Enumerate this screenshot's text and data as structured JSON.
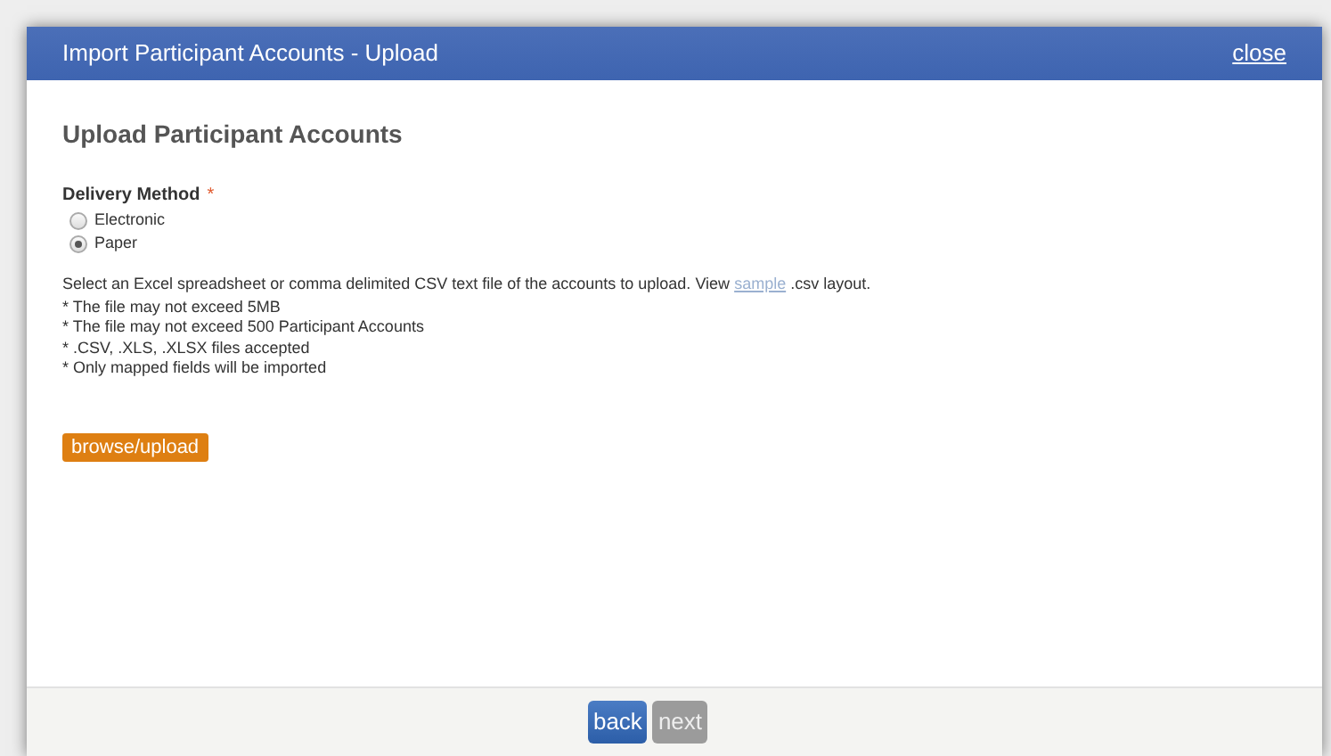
{
  "dialog": {
    "title": "Import Participant Accounts - Upload",
    "close": "close"
  },
  "heading": "Upload Participant Accounts",
  "delivery_method": {
    "label": "Delivery Method",
    "required_mark": "*",
    "options": [
      {
        "label": "Electronic",
        "selected": false
      },
      {
        "label": "Paper",
        "selected": true
      }
    ]
  },
  "instructions": {
    "before_link": "Select an Excel spreadsheet or comma delimited CSV text file of the accounts to upload. View",
    "link": "sample",
    "after_link": ".csv layout."
  },
  "rules": [
    "* The file may not exceed 5MB",
    "* The file may not exceed 500 Participant Accounts",
    "* .CSV, .XLS, .XLSX files accepted",
    "* Only mapped fields will be imported"
  ],
  "upload_button": "browse/upload",
  "footer_buttons": [
    {
      "label": "back",
      "disabled": false
    },
    {
      "label": "next",
      "disabled": true
    }
  ]
}
